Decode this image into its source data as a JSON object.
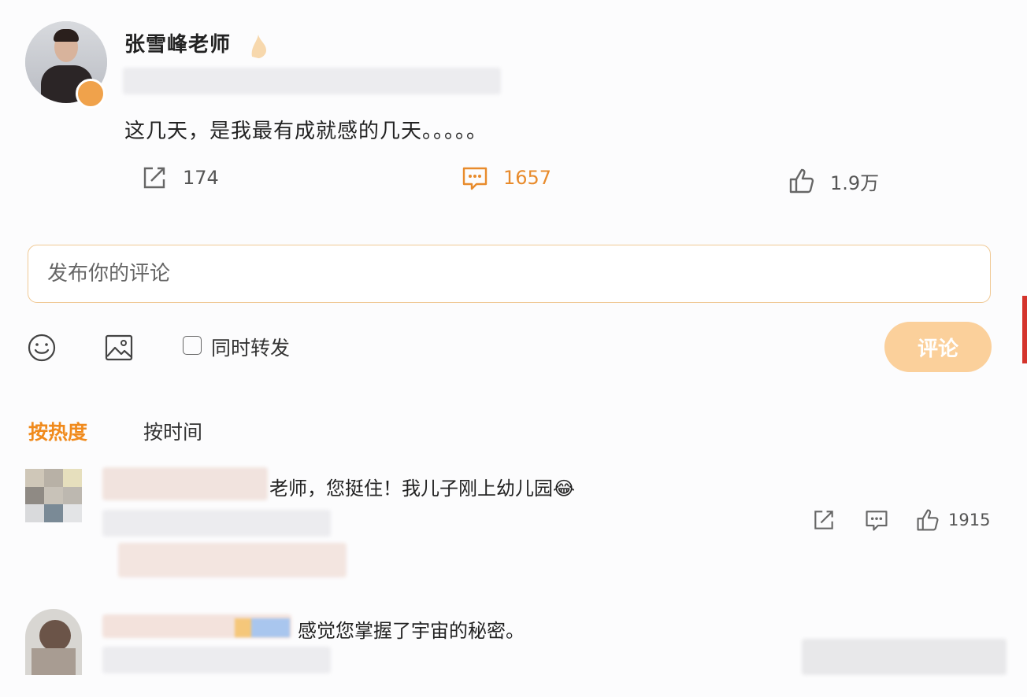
{
  "post": {
    "author": "张雪峰老师",
    "text": "这几天，是我最有成就感的几天。。。。。",
    "actions": {
      "repost_count": "174",
      "comment_count": "1657",
      "like_count": "1.9万"
    }
  },
  "composer": {
    "placeholder": "发布你的评论",
    "repost_label": "同时转发",
    "submit_label": "评论"
  },
  "sort": {
    "hot_label": "按热度",
    "time_label": "按时间"
  },
  "comments": [
    {
      "text": "老师，您挺住！我儿子刚上幼儿园😂",
      "like_count": "1915"
    },
    {
      "text": "感觉您掌握了宇宙的秘密。"
    }
  ],
  "colors": {
    "accent": "#f08a1c",
    "submit_bg": "#fbd09b",
    "input_border": "#f0c995"
  }
}
